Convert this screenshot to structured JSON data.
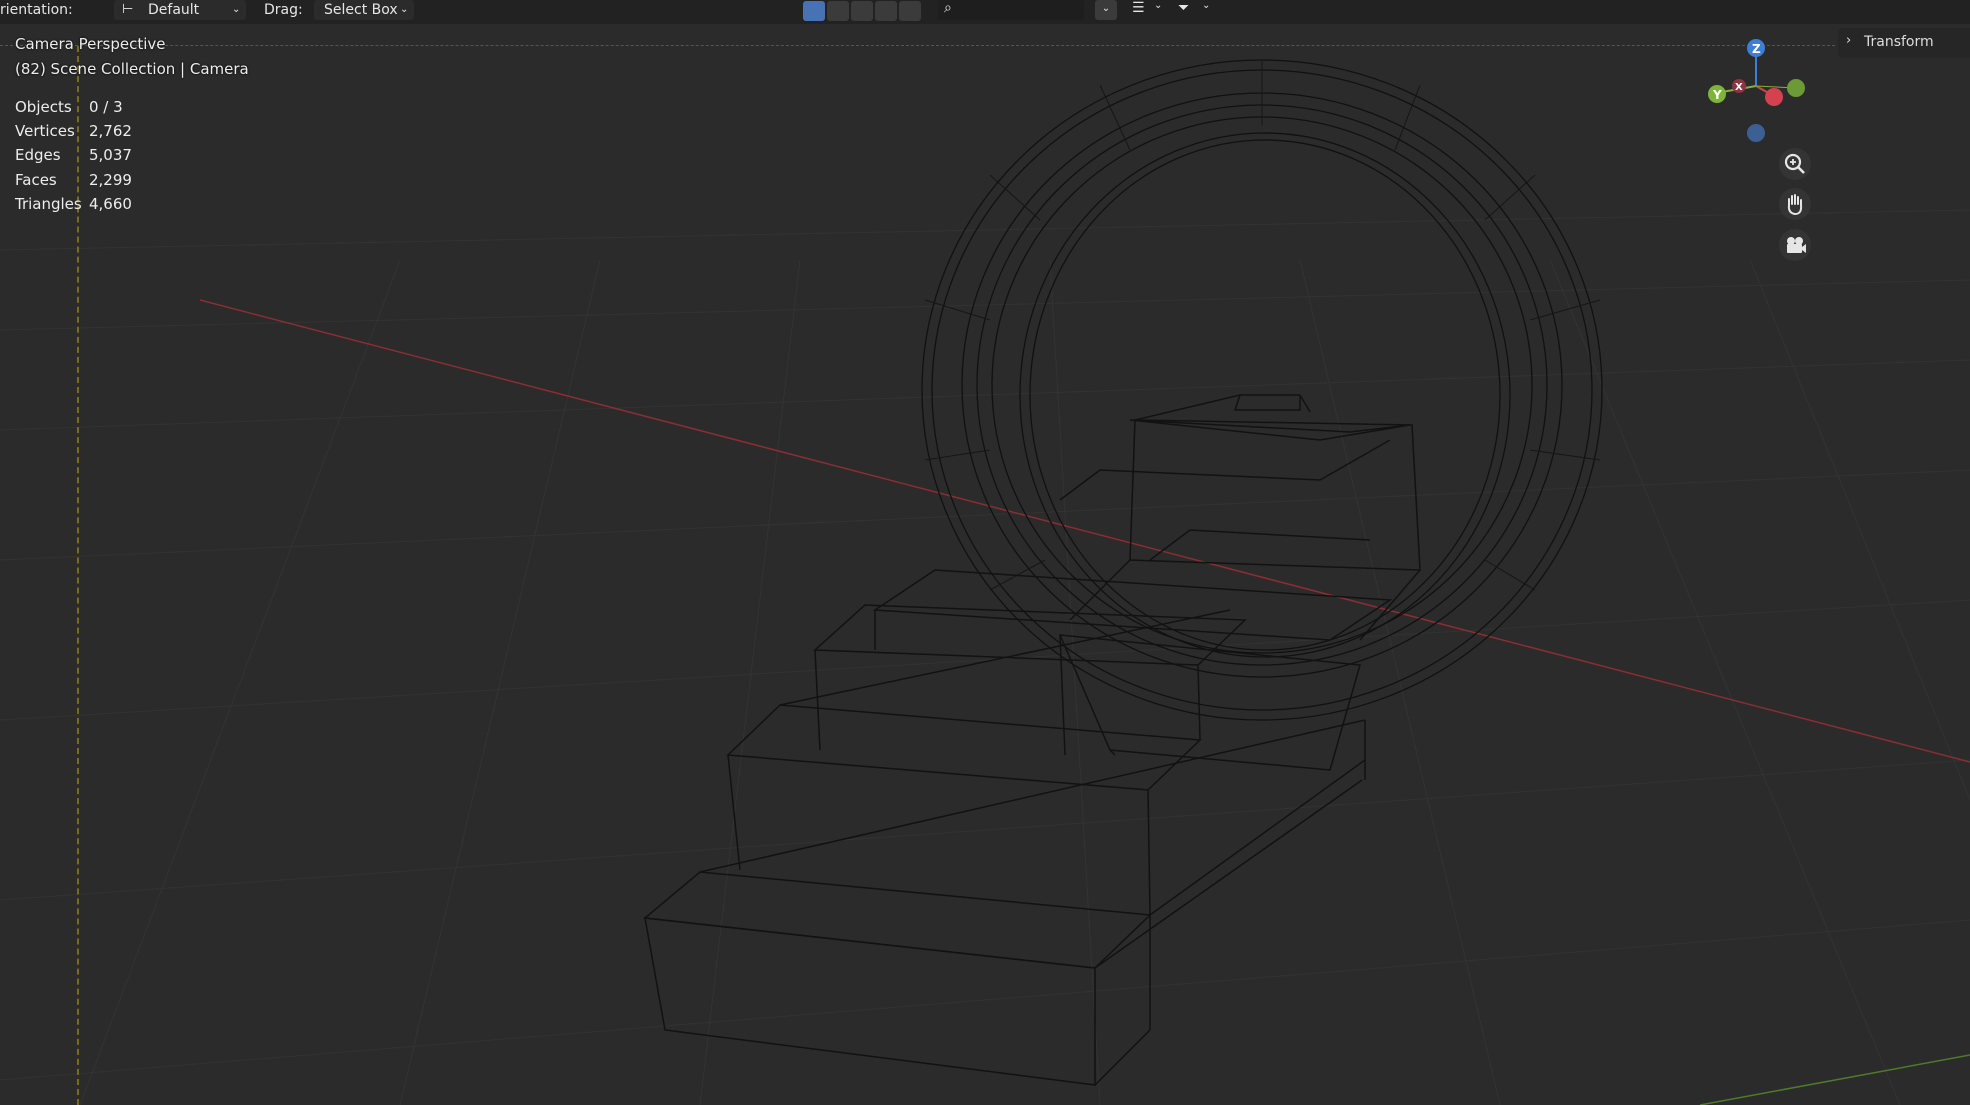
{
  "header": {
    "orientation_label": "rientation:",
    "orientation_value": "Default",
    "drag_label": "Drag:",
    "drag_value": "Select Box",
    "search_placeholder": ""
  },
  "viewport": {
    "view_name": "Camera Perspective",
    "collection_path": "(82) Scene Collection | Camera",
    "stats": [
      {
        "label": "Objects",
        "value": "0 / 3"
      },
      {
        "label": "Vertices",
        "value": "2,762"
      },
      {
        "label": "Edges",
        "value": "5,037"
      },
      {
        "label": "Faces",
        "value": "2,299"
      },
      {
        "label": "Triangles",
        "value": "4,660"
      }
    ]
  },
  "sidebar": {
    "transform_label": "Transform"
  },
  "gizmo": {
    "z_label": "Z",
    "y_label": "Y",
    "x_label": "X"
  },
  "colors": {
    "x_axis": "#d4414f",
    "y_axis": "#7fb43a",
    "z_axis": "#3b7fd6",
    "active_tool": "#4772b3"
  },
  "icons": {
    "zoom": "zoom-icon",
    "pan": "hand-icon",
    "camera": "camera-icon",
    "transform_chevron": "chevron-right-icon"
  }
}
